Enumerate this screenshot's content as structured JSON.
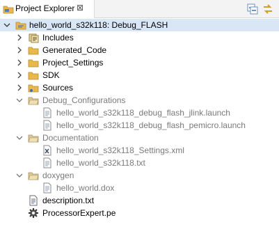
{
  "tab": {
    "title": "Project Explorer",
    "close": "⊠"
  },
  "tree": {
    "root": {
      "label": "hello_world_s32k118: Debug_FLASH"
    },
    "items": [
      {
        "label": "Includes"
      },
      {
        "label": "Generated_Code"
      },
      {
        "label": "Project_Settings"
      },
      {
        "label": "SDK"
      },
      {
        "label": "Sources"
      },
      {
        "label": "Debug_Configurations"
      },
      {
        "label": "hello_world_s32k118_debug_flash_jlink.launch"
      },
      {
        "label": "hello_world_s32k118_debug_flash_pemicro.launch"
      },
      {
        "label": "Documentation"
      },
      {
        "label": "hello_world_s32k118_Settings.xml"
      },
      {
        "label": "hello_world_s32k118.txt"
      },
      {
        "label": "doxygen"
      },
      {
        "label": "hello_world.dox"
      },
      {
        "label": "description.txt"
      },
      {
        "label": "ProcessorExpert.pe"
      }
    ]
  },
  "colors": {
    "selection": "#d8e6f5",
    "folder": "#e8b84a",
    "muted": "#7a7a7a"
  }
}
